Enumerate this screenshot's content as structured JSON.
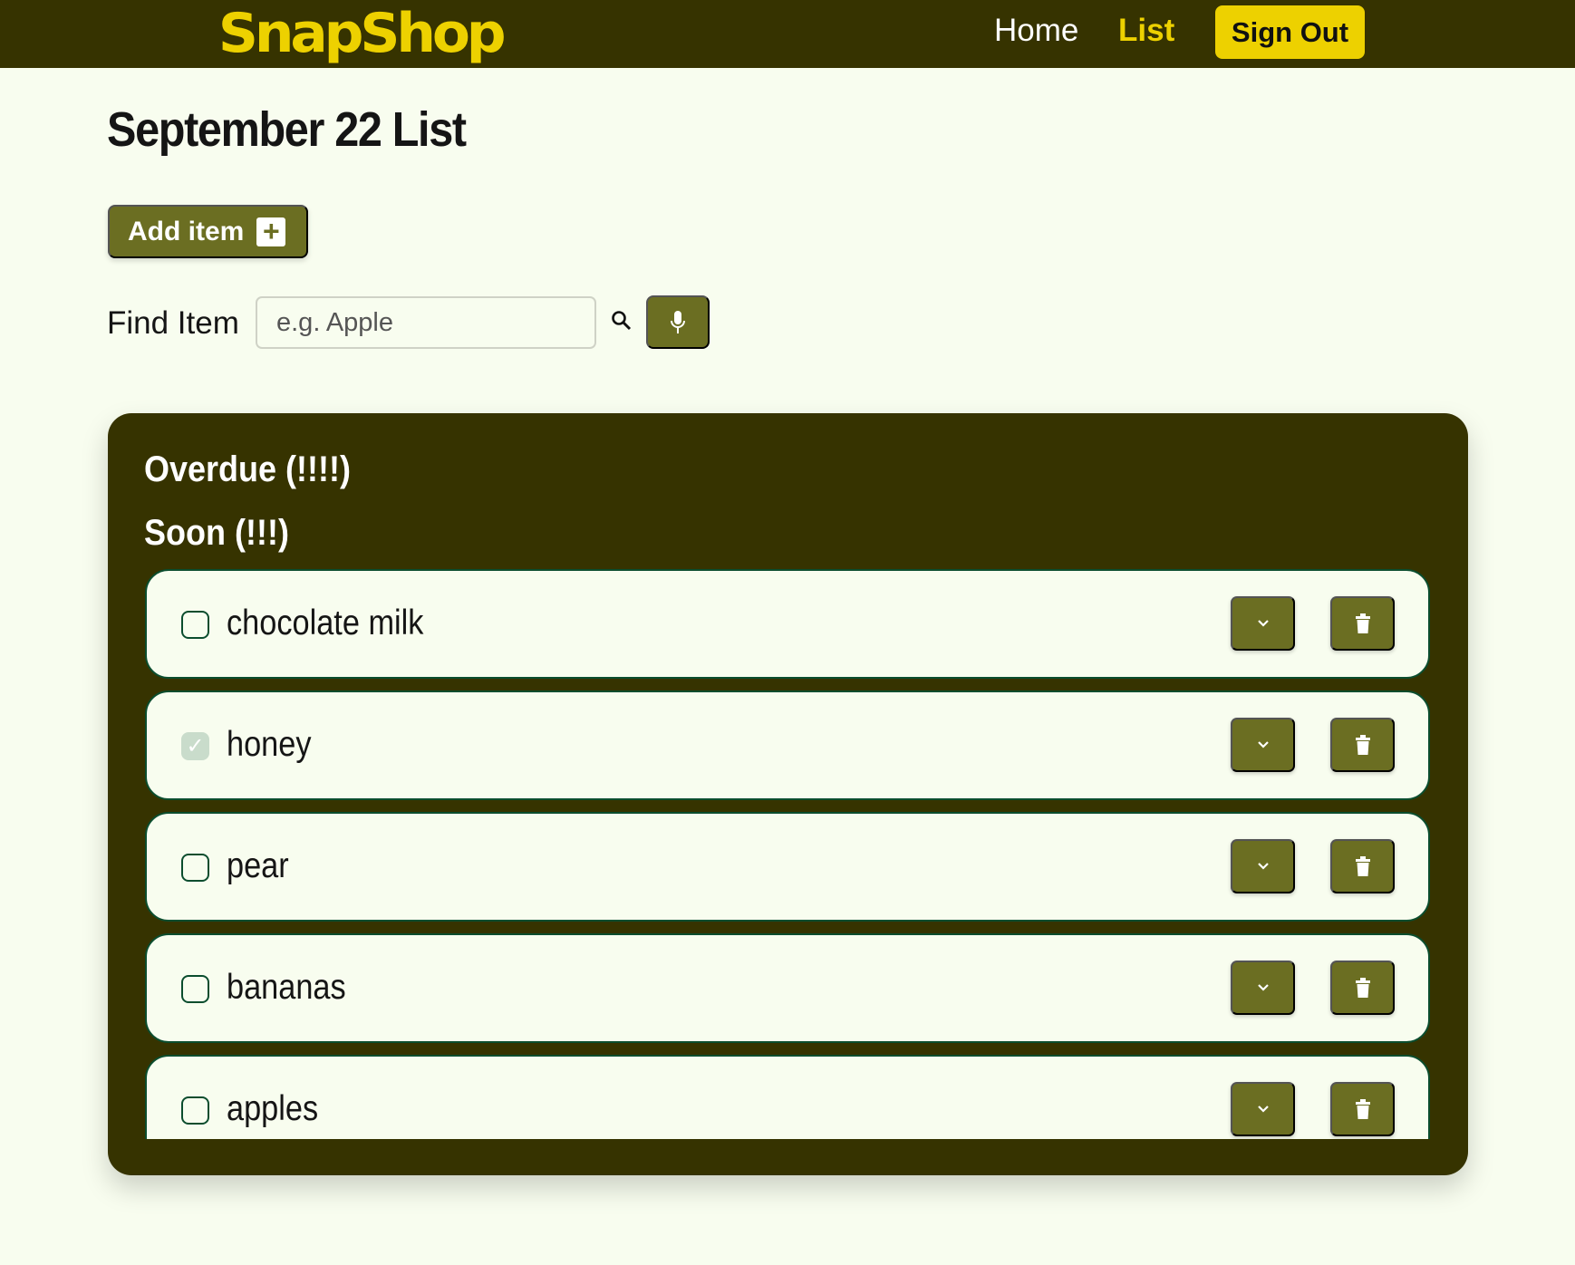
{
  "header": {
    "logo": "SnapShop",
    "nav": [
      {
        "label": "Home",
        "active": false
      },
      {
        "label": "List",
        "active": true
      }
    ],
    "sign_out": "Sign Out"
  },
  "page": {
    "title": "September 22 List",
    "add_item": "Add item",
    "find_label": "Find Item",
    "find_placeholder": "e.g. Apple",
    "find_value": ""
  },
  "sections": {
    "overdue": "Overdue (!!!!)",
    "soon": "Soon (!!!)"
  },
  "items": [
    {
      "name": "chocolate milk",
      "checked": false
    },
    {
      "name": "honey",
      "checked": true
    },
    {
      "name": "pear",
      "checked": false
    },
    {
      "name": "bananas",
      "checked": false
    },
    {
      "name": "apples",
      "checked": false
    }
  ],
  "colors": {
    "header": "#363300",
    "accent": "#edd100",
    "button": "#6b6e22",
    "background": "#f8fdef",
    "row_border": "#0b4d2e"
  }
}
